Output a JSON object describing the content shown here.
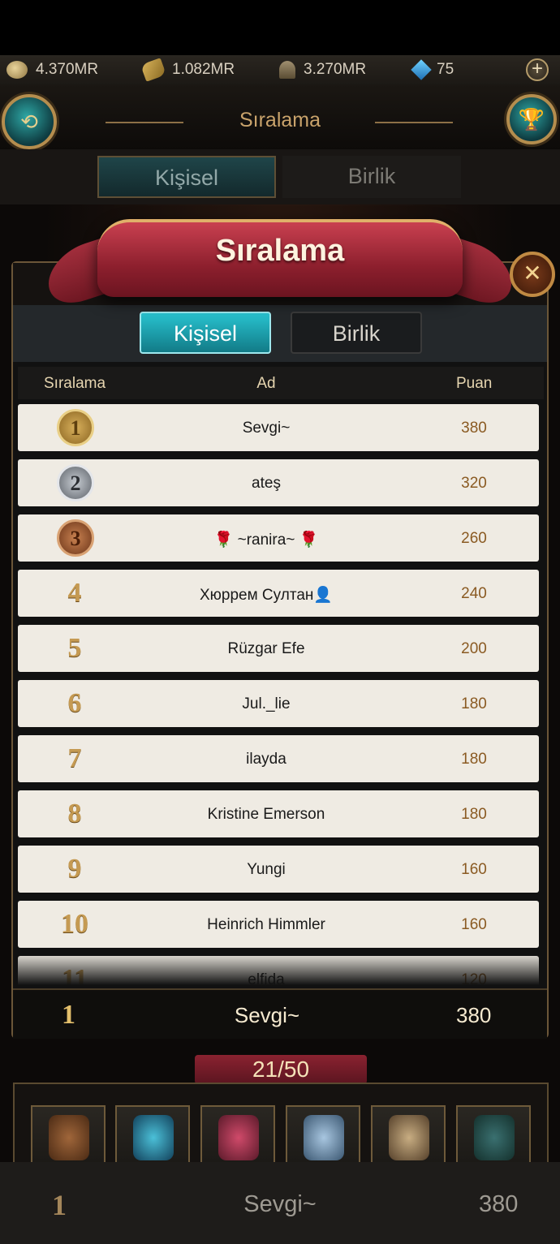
{
  "resources": [
    {
      "icon": "coin-icon",
      "value": "4.370MR"
    },
    {
      "icon": "grain-icon",
      "value": "1.082MR"
    },
    {
      "icon": "helmet-icon",
      "value": "3.270MR"
    },
    {
      "icon": "gem-icon",
      "value": "75"
    }
  ],
  "header": {
    "title": "Sıralama"
  },
  "bg_tabs": {
    "personal": "Kişisel",
    "alliance": "Birlik"
  },
  "modal": {
    "banner_title": "Sıralama",
    "tabs": {
      "personal": "Kişisel",
      "alliance": "Birlik"
    },
    "columns": {
      "rank": "Sıralama",
      "name": "Ad",
      "score": "Puan"
    },
    "rows": [
      {
        "rank": "1",
        "name": "Sevgi~",
        "score": "380"
      },
      {
        "rank": "2",
        "name": "ateş",
        "score": "320"
      },
      {
        "rank": "3",
        "name": "🌹 ~ranira~ 🌹",
        "score": "260"
      },
      {
        "rank": "4",
        "name": "Хюррем Султан👤",
        "score": "240"
      },
      {
        "rank": "5",
        "name": "Rüzgar Efe",
        "score": "200"
      },
      {
        "rank": "6",
        "name": "Jul._lie",
        "score": "180"
      },
      {
        "rank": "7",
        "name": "ilayda",
        "score": "180"
      },
      {
        "rank": "8",
        "name": "Kristine Emerson",
        "score": "180"
      },
      {
        "rank": "9",
        "name": "Yungi",
        "score": "160"
      },
      {
        "rank": "10",
        "name": "Heinrich Himmler",
        "score": "160"
      },
      {
        "rank": "11",
        "name": "elfida",
        "score": "120"
      }
    ],
    "my_row": {
      "rank": "1",
      "name": "Sevgi~",
      "score": "380"
    }
  },
  "progress": {
    "current": "21",
    "separator": "/",
    "total": "50"
  },
  "items": [
    "bag-icon",
    "orb-icon",
    "chest-icon",
    "ring-icon",
    "boots-icon",
    "vest-icon"
  ],
  "footer": {
    "rank": "1",
    "name": "Sevgi~",
    "score": "380"
  }
}
